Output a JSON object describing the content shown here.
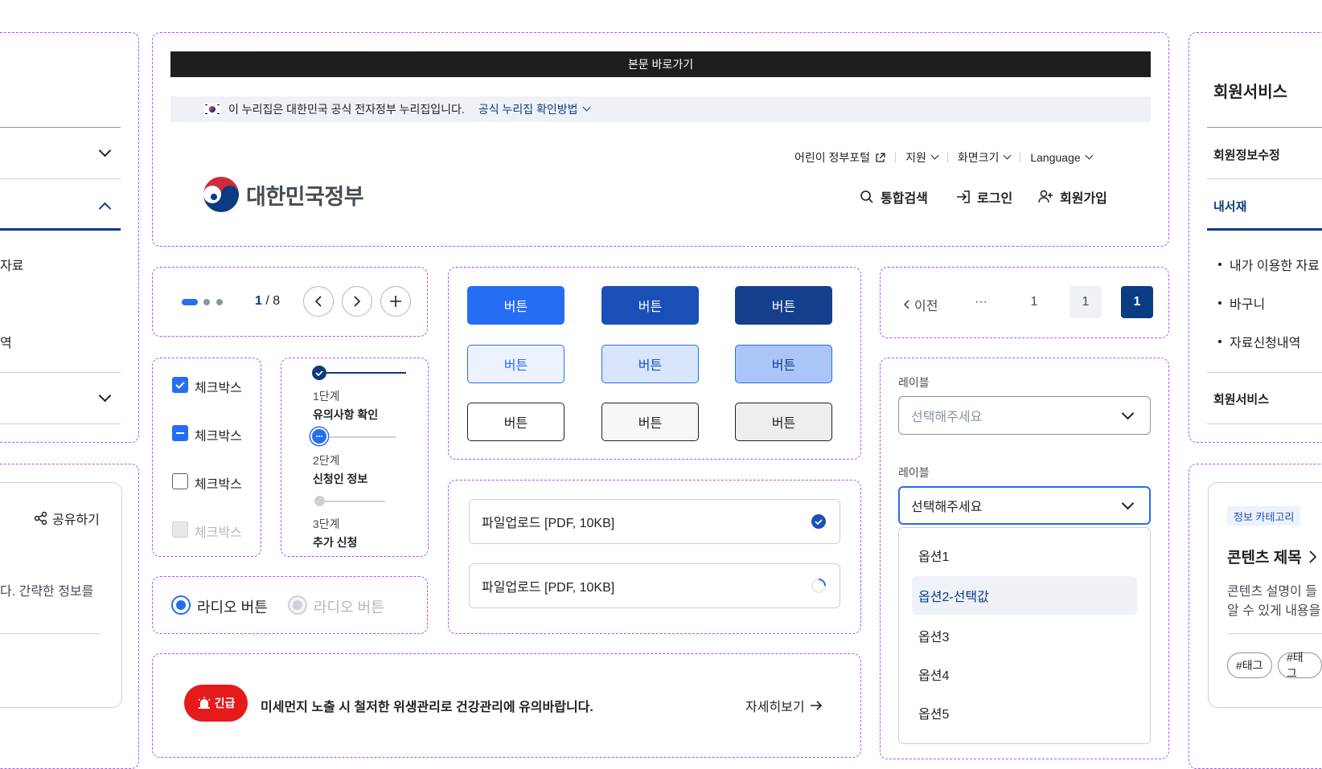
{
  "skip_link": "본문 바로가기",
  "official_banner": {
    "text": "이 누리집은 대한민국 공식 전자정부 누리집입니다.",
    "link": "공식 누리집 확인방법"
  },
  "header": {
    "logo_text": "대한민국정부",
    "utility": [
      "어린이 정부포털",
      "지원",
      "화면크기",
      "Language"
    ],
    "actions": [
      "통합검색",
      "로그인",
      "회원가입"
    ]
  },
  "left_panel": {
    "items": [
      "자료",
      "역"
    ],
    "card_share": "공유하기",
    "card_desc": "다. 간략한 정보를"
  },
  "carousel": {
    "counter_current": "1",
    "counter_sep": " / ",
    "counter_total": "8"
  },
  "buttons": {
    "label": "버튼"
  },
  "checkboxes": {
    "items": [
      "체크박스",
      "체크박스",
      "체크박스",
      "체크박스"
    ]
  },
  "steps": {
    "items": [
      {
        "num": "1단계",
        "title": "유의사항 확인"
      },
      {
        "num": "2단계",
        "title": "신청인 정보"
      },
      {
        "num": "3단계",
        "title": "추가 신청"
      }
    ]
  },
  "radios": {
    "items": [
      "라디오 버튼",
      "라디오 버튼"
    ]
  },
  "files": {
    "items": [
      "파일업로드 [PDF, 10KB]",
      "파일업로드 [PDF, 10KB]"
    ]
  },
  "alert": {
    "badge": "긴급",
    "message": "미세먼지 노출 시 철저한 위생관리로 건강관리에 유의바랍니다.",
    "link": "자세히보기"
  },
  "pagination": {
    "prev": "이전",
    "ellipsis": "···",
    "pages": [
      "1",
      "1",
      "1"
    ]
  },
  "select1": {
    "label": "레이블",
    "placeholder": "선택해주세요"
  },
  "select2": {
    "label": "레이블",
    "value": "선택해주세요",
    "options": [
      "옵션1",
      "옵션2-선택값",
      "옵션3",
      "옵션4",
      "옵션5"
    ]
  },
  "right_panel": {
    "title": "회원서비스",
    "items": [
      "회원정보수정",
      "내서재",
      "회원서비스"
    ],
    "subitems": [
      "내가 이용한 자료",
      "바구니",
      "자료신청내역"
    ],
    "card_category": "정보 카테고리",
    "card_title": "콘텐츠 제목",
    "card_desc_1": "콘텐츠 설명이 들",
    "card_desc_2": "알 수 있게 내용을",
    "tags": [
      "#태그",
      "#태그"
    ]
  },
  "colors": {
    "primary": "#256ef4",
    "primary_dark": "#0b3b82",
    "alert_red": "#e51b1b",
    "border_dashed": "#a855f7"
  }
}
